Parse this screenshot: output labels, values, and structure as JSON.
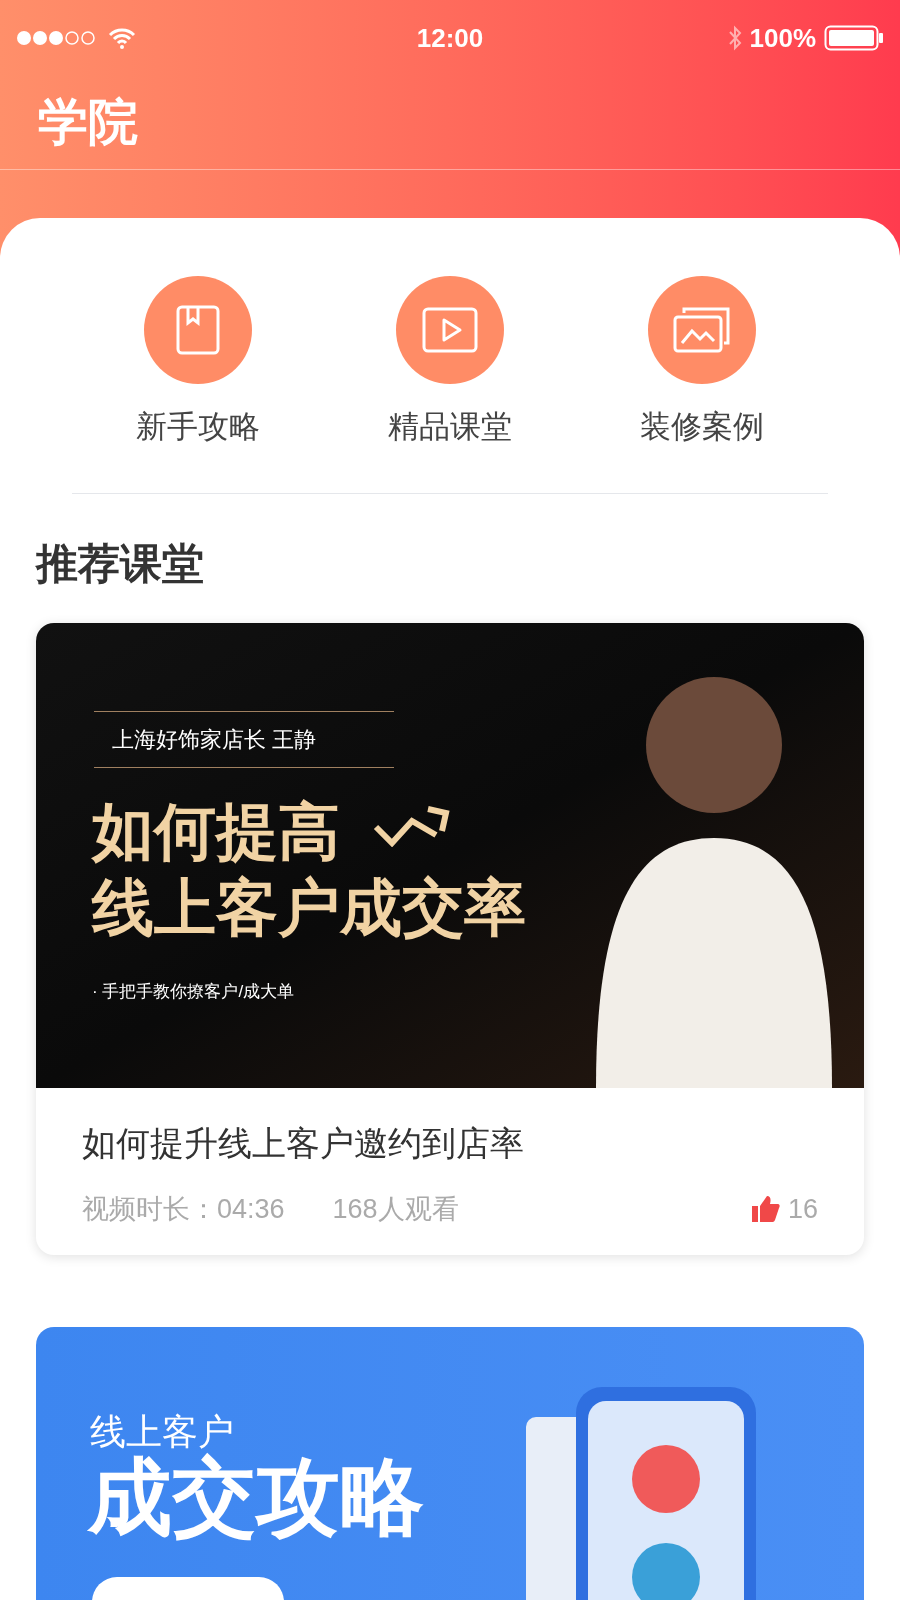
{
  "status_bar": {
    "time": "12:00",
    "battery": "100%"
  },
  "header": {
    "title": "学院"
  },
  "shortcuts": [
    {
      "label": "新手攻略",
      "kind": "book"
    },
    {
      "label": "精品课堂",
      "kind": "play"
    },
    {
      "label": "装修案例",
      "kind": "gallery"
    }
  ],
  "section_title": "推荐课堂",
  "course": {
    "cover": {
      "presenter": "上海好饰家店长 王静",
      "headline_1": "如何提高",
      "headline_2": "线上客户成交率",
      "tagline": "· 手把手教你撩客户/成大单"
    },
    "title": "如何提升线上客户邀约到店率",
    "duration": "视频时长：04:36",
    "views": "168人观看",
    "likes": "16"
  },
  "banner": {
    "subtitle": "线上客户",
    "headline": "成交攻略"
  }
}
